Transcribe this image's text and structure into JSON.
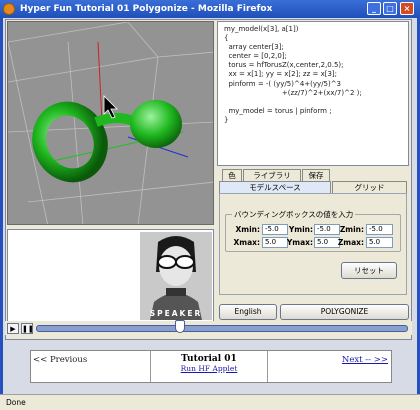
{
  "window": {
    "title": "Hyper Fun Tutorial 01 Polygonize - Mozilla Firefox"
  },
  "code": {
    "lines": [
      "my_model(x[3], a[1])",
      "{",
      "  array center[3];",
      "  center = [0,2,0];",
      "  torus = hfTorusZ(x,center,2,0.5);",
      "  xx = x[1]; yy = x[2]; zz = x[3];",
      "  pinform = -( (yy/5)^4+(yy/5)^3",
      "                          +(zz/7)^2+(xx/7)^2 );",
      "",
      "  my_model = torus | pinform ;",
      "}"
    ]
  },
  "tabs_top": [
    {
      "label": "色"
    },
    {
      "label": "ライブラリ"
    },
    {
      "label": "保存"
    }
  ],
  "tabs_bottom": [
    {
      "label": "モデルスペース"
    },
    {
      "label": "グリッド"
    }
  ],
  "bbox_group": {
    "title": "バウンディングボックスの値を入力",
    "fields": [
      {
        "label": "Xmin:",
        "value": "-5.0"
      },
      {
        "label": "Ymin:",
        "value": "-5.0"
      },
      {
        "label": "Zmin:",
        "value": "-5.0"
      },
      {
        "label": "Xmax:",
        "value": "5.0"
      },
      {
        "label": "Ymax:",
        "value": "5.0"
      },
      {
        "label": "Zmax:",
        "value": "5.0"
      }
    ]
  },
  "buttons": {
    "reset": "リセット",
    "english": "English",
    "polygonize": "POLYGONIZE"
  },
  "video": {
    "caption": "SPEAKER"
  },
  "player": {
    "play_icon": "play-icon",
    "pause_icon": "pause-icon",
    "progress": 0.38
  },
  "nav": {
    "previous": "<< Previous",
    "title": "Tutorial 01",
    "subtitle": "Run HF Applet",
    "next": "Next -- >>"
  },
  "status": {
    "text": "Done"
  },
  "colors": {
    "model": "#1fb81f",
    "titlebar": "#2450c0",
    "link": "#1a1aa8"
  }
}
